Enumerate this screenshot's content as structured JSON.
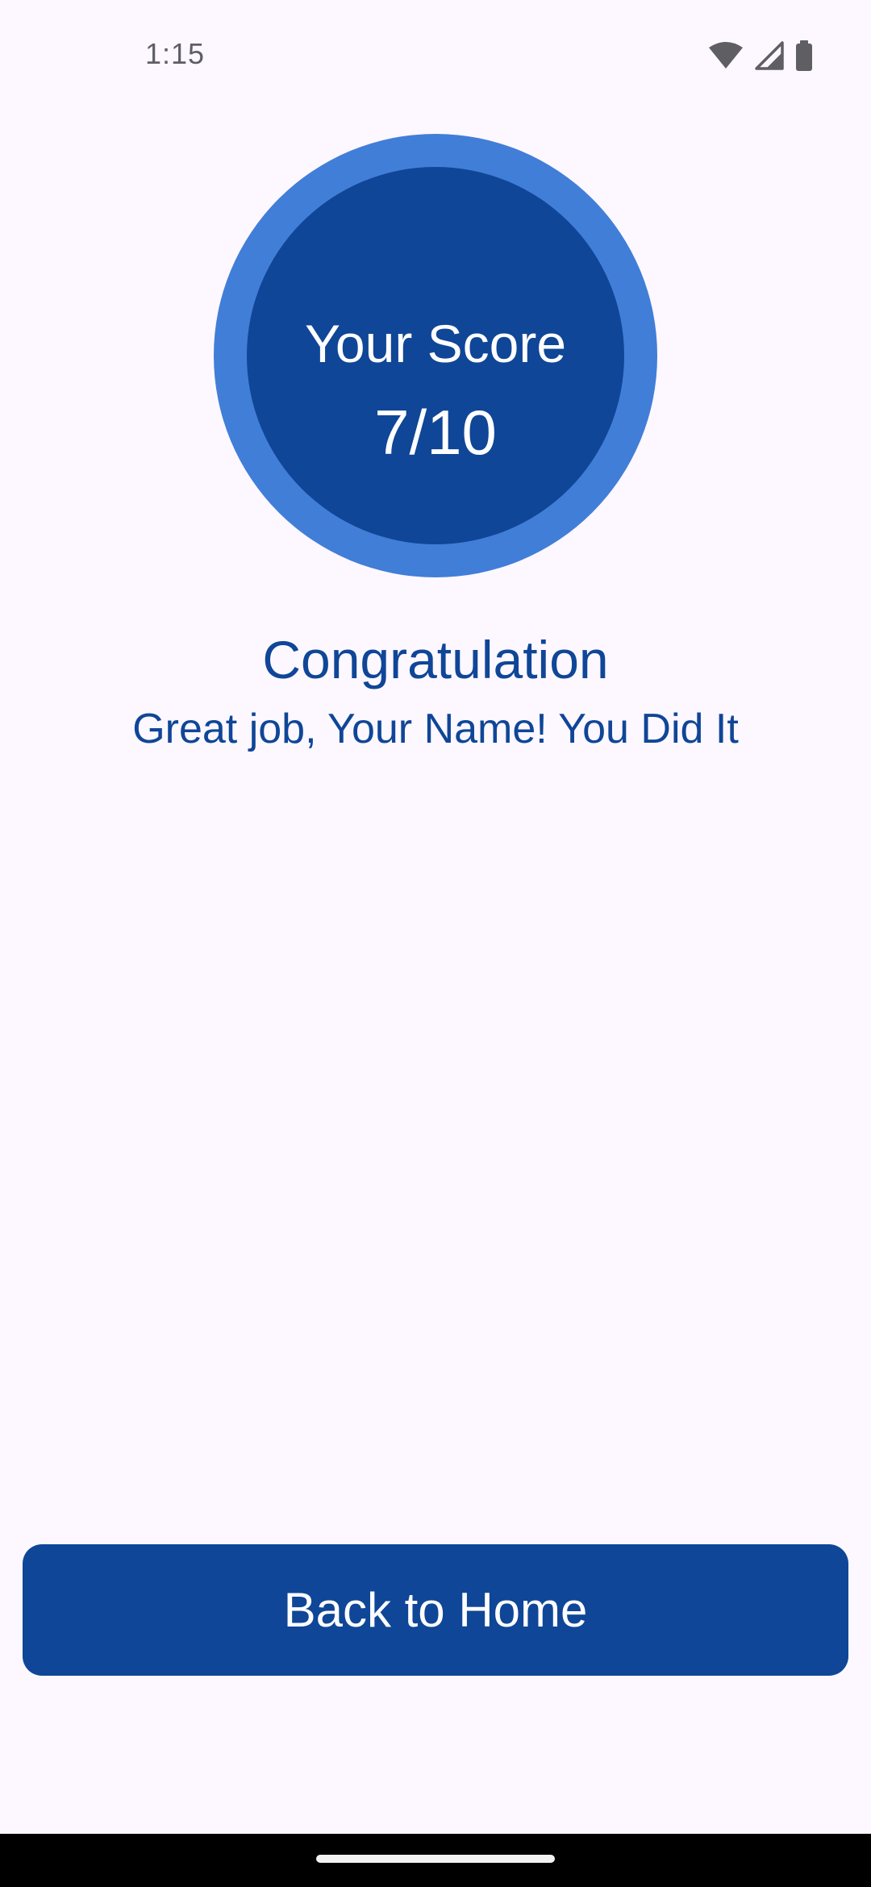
{
  "status_bar": {
    "time": "1:15",
    "icons": [
      "wifi-icon",
      "signal-icon",
      "battery-icon"
    ]
  },
  "score": {
    "label": "Your Score",
    "value": "7/10",
    "correct": 7,
    "total": 10
  },
  "result": {
    "title": "Congratulation",
    "message": "Great job, Your Name! You Did It"
  },
  "actions": {
    "home_button_label": "Back to Home"
  },
  "colors": {
    "background": "#fdf7ff",
    "primary": "#0f4697",
    "ring": "#417ed8",
    "on_primary": "#ffffff"
  }
}
